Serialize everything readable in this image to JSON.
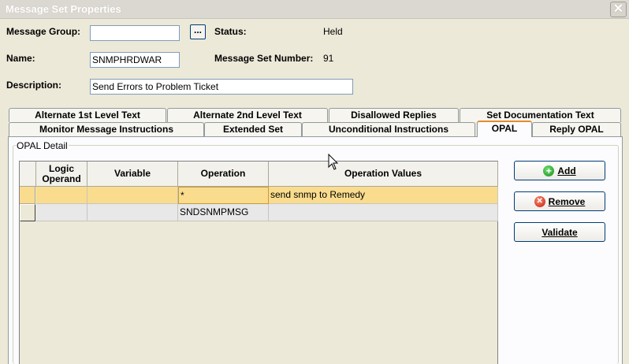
{
  "window": {
    "title": "Message Set Properties",
    "close_glyph": "✕"
  },
  "form": {
    "message_group_label": "Message Group:",
    "message_group_value": "",
    "browse_label": "...",
    "status_label": "Status:",
    "status_value": "Held",
    "name_label": "Name:",
    "name_value": "SNMPHRDWAR",
    "msg_set_number_label": "Message Set Number:",
    "msg_set_number_value": "91",
    "description_label": "Description:",
    "description_value": "Send Errors to Problem Ticket"
  },
  "tabs": {
    "row1": [
      "Alternate 1st Level Text",
      "Alternate 2nd Level Text",
      "Disallowed Replies",
      "Set Documentation Text"
    ],
    "row2": [
      "Monitor Message Instructions",
      "Extended Set",
      "Unconditional Instructions",
      "OPAL",
      "Reply OPAL"
    ],
    "active": "OPAL"
  },
  "opal": {
    "group_title": "OPAL Detail",
    "columns": [
      "Logic Operand",
      "Variable",
      "Operation",
      "Operation Values"
    ],
    "rows": [
      {
        "logic_operand": "",
        "variable": "",
        "operation": "*",
        "operation_values": "send snmp to Remedy"
      },
      {
        "logic_operand": "",
        "variable": "",
        "operation": "SNDSNMPMSG",
        "operation_values": ""
      }
    ]
  },
  "buttons": {
    "add": "Add",
    "remove": "Remove",
    "validate": "Validate"
  },
  "icons": {
    "add": "add-icon",
    "remove": "remove-icon"
  },
  "colors": {
    "selected_row": "#f9dc8d",
    "active_tab_accent": "#e68b2c",
    "window_bg": "#ece9d8"
  }
}
